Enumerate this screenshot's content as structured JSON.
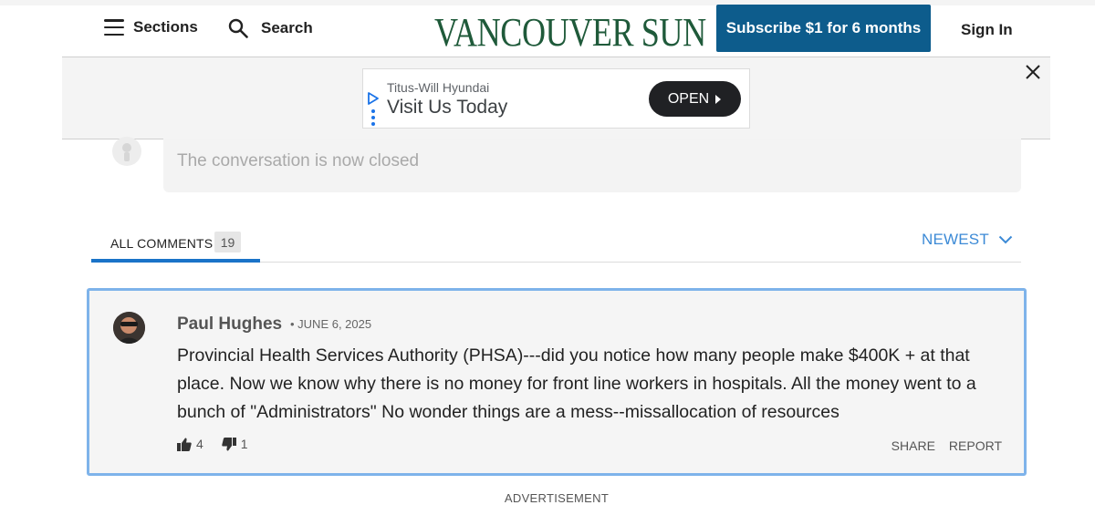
{
  "header": {
    "sections_label": "Sections",
    "search_label": "Search",
    "logo_text": "VANCOUVER SUN",
    "subscribe_label": "Subscribe $1 for 6 months",
    "signin_label": "Sign In"
  },
  "ad": {
    "advertiser": "Titus-Will Hyundai",
    "headline": "Visit Us Today",
    "cta": "OPEN"
  },
  "conversation": {
    "closed_text": "The conversation is now closed"
  },
  "comments_tabs": {
    "all_label": "ALL COMMENTS",
    "count": "19",
    "sort_label": "NEWEST"
  },
  "comment": {
    "author": "Paul Hughes",
    "date": "• JUNE 6, 2025",
    "body": "Provincial Health Services Authority (PHSA)---did you notice how many people make $400K + at that place. Now we know why there is no money for front line workers in hospitals. All the money went to a bunch of \"Administrators\" No wonder things are a mess--missallocation of resources",
    "likes": "4",
    "dislikes": "1",
    "share_label": "SHARE",
    "report_label": "REPORT"
  },
  "footer": {
    "advertisement_label": "ADVERTISEMENT"
  },
  "colors": {
    "brand_green": "#1f5a3a",
    "subscribe_blue": "#0d5c8c",
    "accent_blue": "#3c8ad6",
    "comment_border": "#7eb3ea"
  }
}
